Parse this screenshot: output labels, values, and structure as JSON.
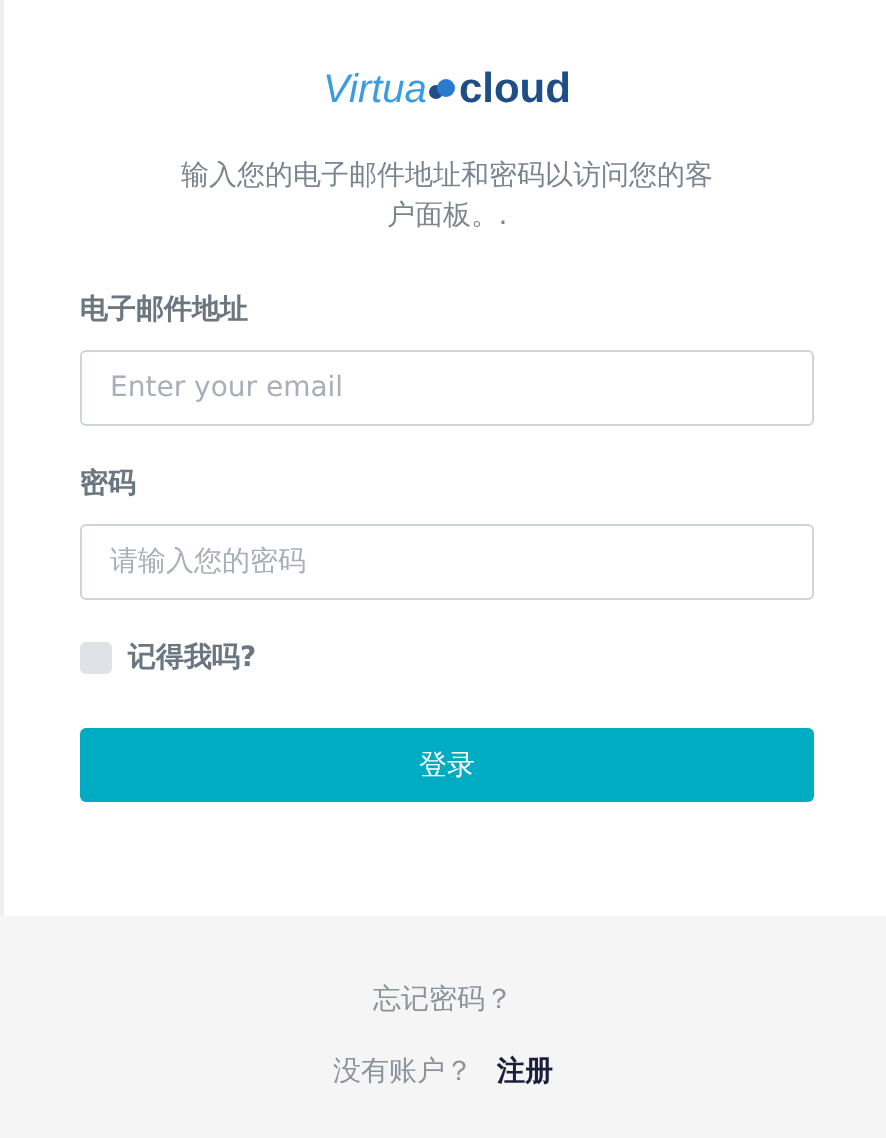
{
  "logo": {
    "light": "Virtua",
    "bold": "cloud"
  },
  "intro": "输入您的电子邮件地址和密码以访问您的客户面板。.",
  "fields": [
    {
      "label": "电子邮件地址",
      "placeholder": "Enter your email"
    },
    {
      "label": "密码",
      "placeholder": "请输入您的密码"
    }
  ],
  "remember": {
    "label": "记得我吗?",
    "checked": false
  },
  "submit": "登录",
  "footer": {
    "forgot": "忘记密码？",
    "no_account": "没有账户？",
    "register": "注册"
  }
}
